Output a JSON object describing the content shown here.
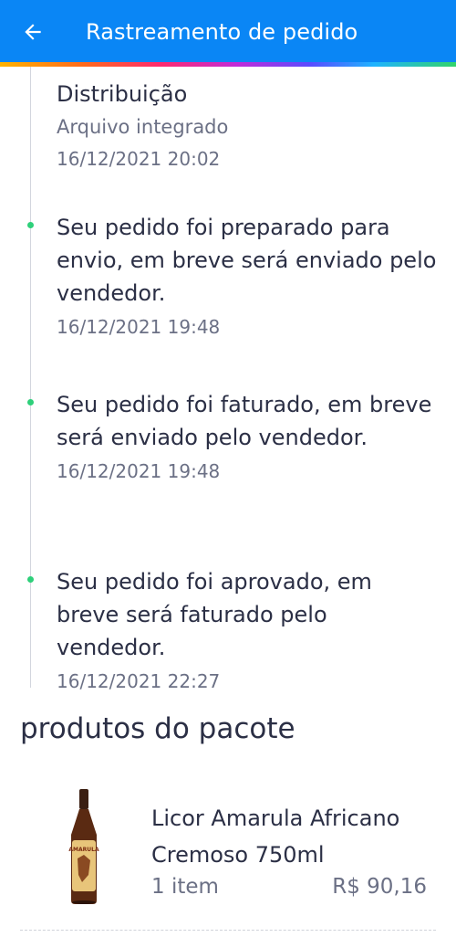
{
  "header": {
    "title": "Rastreamento de pedido",
    "back_icon": "arrow-left-icon"
  },
  "timeline": {
    "events": [
      {
        "message": "Distribuição",
        "sub": "Arquivo integrado",
        "date": "16/12/2021 20:02"
      },
      {
        "message": "Seu pedido foi preparado para envio, em breve será enviado pelo vendedor.",
        "date": "16/12/2021 19:48"
      },
      {
        "message": "Seu pedido foi faturado, em breve será enviado pelo vendedor.",
        "date": "16/12/2021 19:48"
      },
      {
        "message": "Seu pedido foi aprovado, em breve será faturado pelo vendedor.",
        "date": "16/12/2021 22:27"
      }
    ]
  },
  "package": {
    "title": "produtos do pacote",
    "products": [
      {
        "name": "Licor Amarula Africano Cremoso 750ml",
        "quantity": "1 item",
        "price": "R$ 90,16",
        "image_label": "AMARULA"
      }
    ]
  },
  "colors": {
    "appbar": "#0a86f5",
    "timeline_dot": "#2ed07a",
    "text_primary": "#2b2f45",
    "text_secondary": "#6b7085"
  }
}
